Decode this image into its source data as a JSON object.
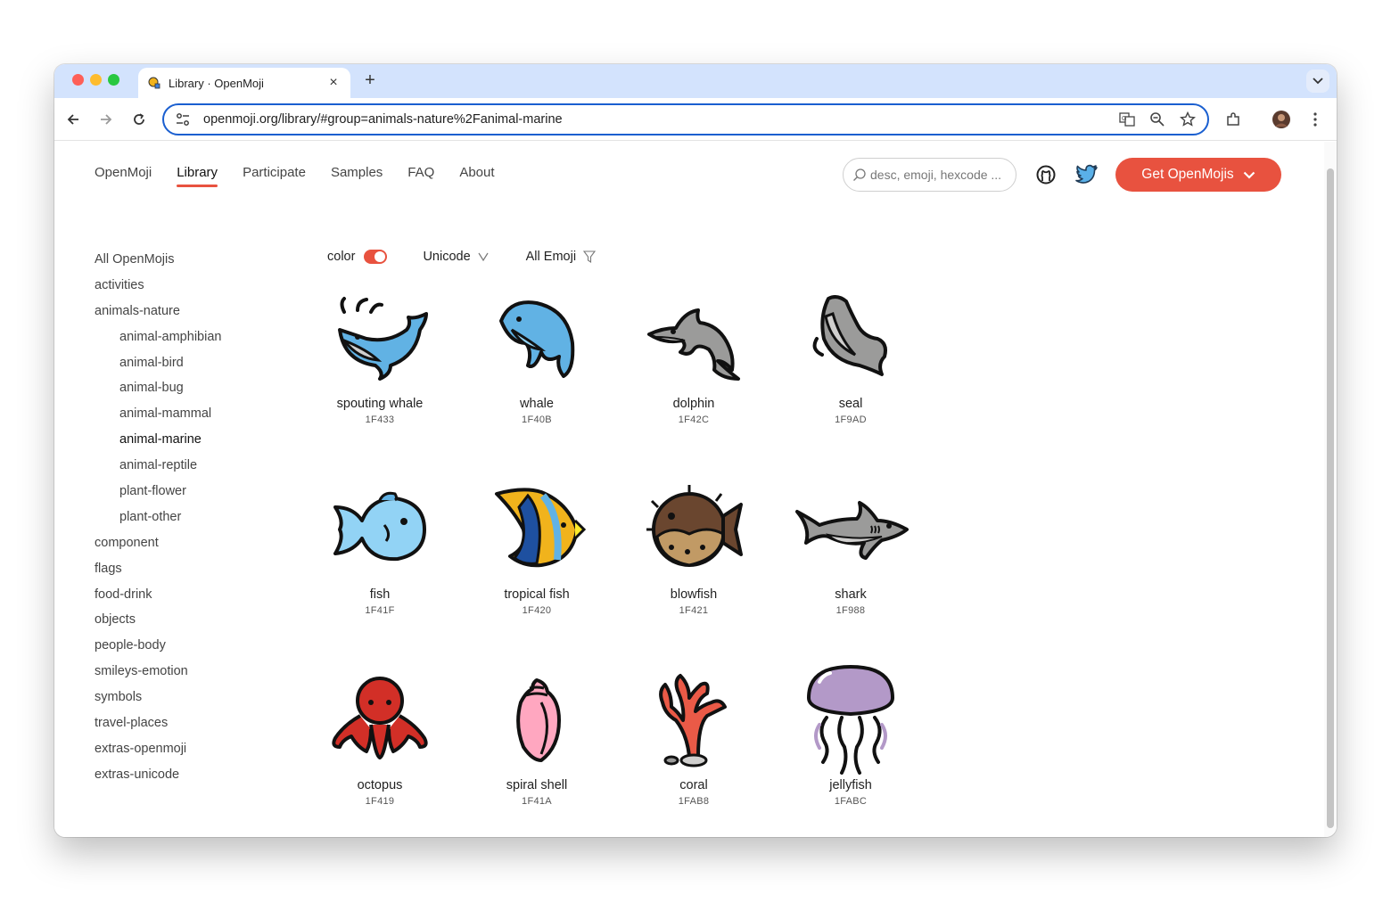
{
  "browser": {
    "tab_title": "Library · OpenMoji",
    "new_tab_label": "+",
    "url": "openmoji.org/library/#group=animals-nature%2Fanimal-marine"
  },
  "nav": {
    "items": [
      "OpenMoji",
      "Library",
      "Participate",
      "Samples",
      "FAQ",
      "About"
    ],
    "active_index": 1,
    "search_placeholder": "desc, emoji, hexcode ...",
    "get_button_label": "Get OpenMojis"
  },
  "sidebar": {
    "items": [
      {
        "label": "All OpenMojis",
        "level": 0
      },
      {
        "label": "activities",
        "level": 0
      },
      {
        "label": "animals-nature",
        "level": 0
      },
      {
        "label": "animal-amphibian",
        "level": 1
      },
      {
        "label": "animal-bird",
        "level": 1
      },
      {
        "label": "animal-bug",
        "level": 1
      },
      {
        "label": "animal-mammal",
        "level": 1
      },
      {
        "label": "animal-marine",
        "level": 1,
        "active": true
      },
      {
        "label": "animal-reptile",
        "level": 1
      },
      {
        "label": "plant-flower",
        "level": 1
      },
      {
        "label": "plant-other",
        "level": 1
      },
      {
        "label": "component",
        "level": 0
      },
      {
        "label": "flags",
        "level": 0
      },
      {
        "label": "food-drink",
        "level": 0
      },
      {
        "label": "objects",
        "level": 0
      },
      {
        "label": "people-body",
        "level": 0
      },
      {
        "label": "smileys-emotion",
        "level": 0
      },
      {
        "label": "symbols",
        "level": 0
      },
      {
        "label": "travel-places",
        "level": 0
      },
      {
        "label": "extras-openmoji",
        "level": 0
      },
      {
        "label": "extras-unicode",
        "level": 0
      }
    ]
  },
  "filters": {
    "color_label": "color",
    "color_on": true,
    "unicode_label": "Unicode",
    "emoji_label": "All Emoji"
  },
  "emojis": [
    {
      "name": "spouting whale",
      "code": "1F433",
      "icon": "spouting-whale-icon"
    },
    {
      "name": "whale",
      "code": "1F40B",
      "icon": "whale-icon"
    },
    {
      "name": "dolphin",
      "code": "1F42C",
      "icon": "dolphin-icon"
    },
    {
      "name": "seal",
      "code": "1F9AD",
      "icon": "seal-icon"
    },
    {
      "name": "fish",
      "code": "1F41F",
      "icon": "fish-icon"
    },
    {
      "name": "tropical fish",
      "code": "1F420",
      "icon": "tropical-fish-icon"
    },
    {
      "name": "blowfish",
      "code": "1F421",
      "icon": "blowfish-icon"
    },
    {
      "name": "shark",
      "code": "1F988",
      "icon": "shark-icon"
    },
    {
      "name": "octopus",
      "code": "1F419",
      "icon": "octopus-icon"
    },
    {
      "name": "spiral shell",
      "code": "1F41A",
      "icon": "spiral-shell-icon"
    },
    {
      "name": "coral",
      "code": "1FAB8",
      "icon": "coral-icon"
    },
    {
      "name": "jellyfish",
      "code": "1FABC",
      "icon": "jellyfish-icon"
    }
  ],
  "colors": {
    "accent": "#e8523f",
    "omnibox_border": "#1a5fd0",
    "tabbar": "#d3e3fd"
  }
}
